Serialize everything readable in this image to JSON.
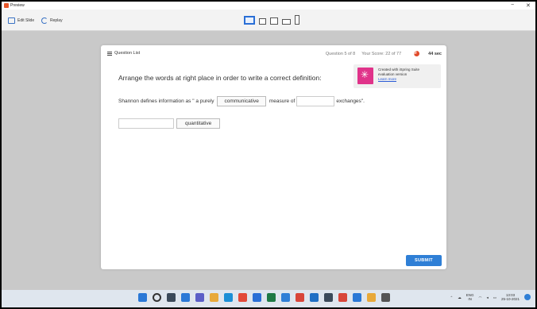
{
  "window": {
    "title": "Preview",
    "controls": [
      "−",
      "✕"
    ]
  },
  "toolbar": {
    "edit_slide_label": "Edit Slide",
    "replay_label": "Replay"
  },
  "header": {
    "question_list_label": "Question List",
    "question_counter": "Question 5 of 8",
    "score": "Your Score: 22 of 77",
    "timer": "44 sec"
  },
  "question": {
    "prompt": "Arrange the words at right place in order to write a correct definition:",
    "sentence_part1": "Shannon defines information as \" a purely",
    "placed_word": "communicative",
    "sentence_part2": "measure of",
    "sentence_part3": "exchanges\".",
    "word_bank": [
      "quantitative"
    ]
  },
  "promo": {
    "line1": "Created with iSpring Suite",
    "line2": "evaluation version",
    "learn_more": "Learn more"
  },
  "submit_label": "SUBMIT",
  "taskbar": {
    "lang_top": "ENG",
    "lang_bottom": "IN",
    "time": "13:03",
    "date": "25-10-2021"
  }
}
